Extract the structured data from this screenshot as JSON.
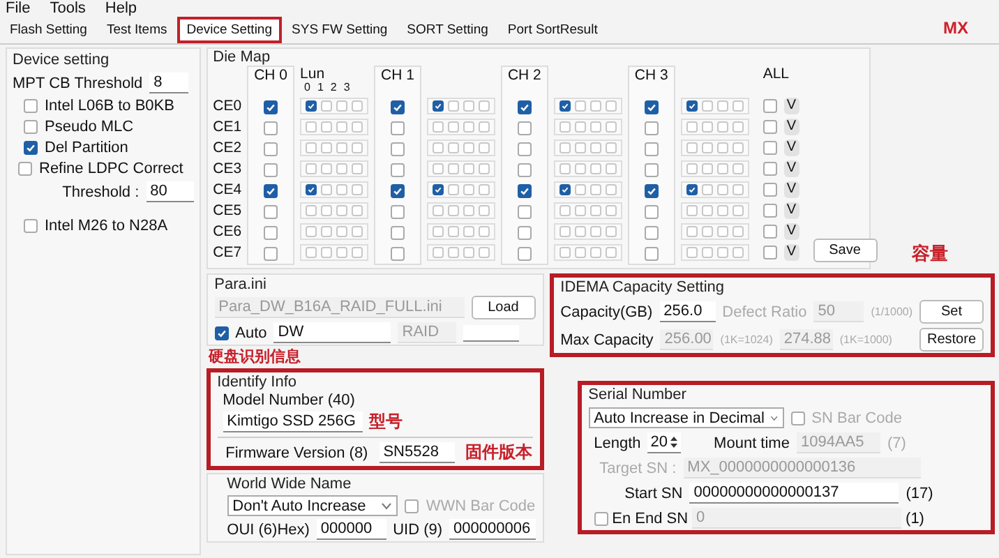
{
  "menu": [
    {
      "label": "File"
    },
    {
      "label": "Tools"
    },
    {
      "label": "Help"
    }
  ],
  "tabs": [
    {
      "label": "Flash Setting",
      "selected": false
    },
    {
      "label": "Test Items",
      "selected": false
    },
    {
      "label": "Device Setting",
      "selected": true
    },
    {
      "label": "SYS FW Setting",
      "selected": false
    },
    {
      "label": "SORT Setting",
      "selected": false
    },
    {
      "label": "Port SortResult",
      "selected": false
    }
  ],
  "corner_note": "MX",
  "device_setting": {
    "title": "Device setting",
    "items": [
      {
        "kind": "field",
        "label": "MPT CB Threshold",
        "value": "8"
      },
      {
        "kind": "checkbox",
        "label": "Intel L06B to B0KB",
        "checked": false
      },
      {
        "kind": "checkbox",
        "label": "Pseudo MLC",
        "checked": false
      },
      {
        "kind": "checkbox",
        "label": "Del Partition",
        "checked": true
      },
      {
        "kind": "checkbox",
        "label": "Refine LDPC Correct",
        "checked": false
      },
      {
        "kind": "subfield",
        "label": "Threshold :",
        "value": "80"
      },
      {
        "kind": "checkbox",
        "label": "Intel M26 to N28A",
        "checked": false
      }
    ]
  },
  "die_map": {
    "title": "Die Map",
    "lun_label": "Lun",
    "lun_numbers": [
      "0",
      "1",
      "2",
      "3"
    ],
    "channels": [
      "CH 0",
      "CH 1",
      "CH 2",
      "CH 3"
    ],
    "all_label": "ALL",
    "save": "Save",
    "rows": [
      {
        "ce": "CE0",
        "channels": [
          {
            "checked": true,
            "luns": [
              true,
              false,
              false,
              false
            ]
          },
          {
            "checked": true,
            "luns": [
              true,
              false,
              false,
              false
            ]
          },
          {
            "checked": true,
            "luns": [
              true,
              false,
              false,
              false
            ]
          },
          {
            "checked": true,
            "luns": [
              true,
              false,
              false,
              false
            ]
          }
        ],
        "all": false,
        "v": "V"
      },
      {
        "ce": "CE1",
        "channels": [
          {
            "checked": false,
            "luns": [
              false,
              false,
              false,
              false
            ]
          },
          {
            "checked": false,
            "luns": [
              false,
              false,
              false,
              false
            ]
          },
          {
            "checked": false,
            "luns": [
              false,
              false,
              false,
              false
            ]
          },
          {
            "checked": false,
            "luns": [
              false,
              false,
              false,
              false
            ]
          }
        ],
        "all": false,
        "v": "V"
      },
      {
        "ce": "CE2",
        "channels": [
          {
            "checked": false,
            "luns": [
              false,
              false,
              false,
              false
            ]
          },
          {
            "checked": false,
            "luns": [
              false,
              false,
              false,
              false
            ]
          },
          {
            "checked": false,
            "luns": [
              false,
              false,
              false,
              false
            ]
          },
          {
            "checked": false,
            "luns": [
              false,
              false,
              false,
              false
            ]
          }
        ],
        "all": false,
        "v": "V"
      },
      {
        "ce": "CE3",
        "channels": [
          {
            "checked": false,
            "luns": [
              false,
              false,
              false,
              false
            ]
          },
          {
            "checked": false,
            "luns": [
              false,
              false,
              false,
              false
            ]
          },
          {
            "checked": false,
            "luns": [
              false,
              false,
              false,
              false
            ]
          },
          {
            "checked": false,
            "luns": [
              false,
              false,
              false,
              false
            ]
          }
        ],
        "all": false,
        "v": "V"
      },
      {
        "ce": "CE4",
        "channels": [
          {
            "checked": true,
            "luns": [
              true,
              false,
              false,
              false
            ]
          },
          {
            "checked": true,
            "luns": [
              true,
              false,
              false,
              false
            ]
          },
          {
            "checked": true,
            "luns": [
              true,
              false,
              false,
              false
            ]
          },
          {
            "checked": true,
            "luns": [
              true,
              false,
              false,
              false
            ]
          }
        ],
        "all": false,
        "v": "V"
      },
      {
        "ce": "CE5",
        "channels": [
          {
            "checked": false,
            "luns": [
              false,
              false,
              false,
              false
            ]
          },
          {
            "checked": false,
            "luns": [
              false,
              false,
              false,
              false
            ]
          },
          {
            "checked": false,
            "luns": [
              false,
              false,
              false,
              false
            ]
          },
          {
            "checked": false,
            "luns": [
              false,
              false,
              false,
              false
            ]
          }
        ],
        "all": false,
        "v": "V"
      },
      {
        "ce": "CE6",
        "channels": [
          {
            "checked": false,
            "luns": [
              false,
              false,
              false,
              false
            ]
          },
          {
            "checked": false,
            "luns": [
              false,
              false,
              false,
              false
            ]
          },
          {
            "checked": false,
            "luns": [
              false,
              false,
              false,
              false
            ]
          },
          {
            "checked": false,
            "luns": [
              false,
              false,
              false,
              false
            ]
          }
        ],
        "all": false,
        "v": "V"
      },
      {
        "ce": "CE7",
        "channels": [
          {
            "checked": false,
            "luns": [
              false,
              false,
              false,
              false
            ]
          },
          {
            "checked": false,
            "luns": [
              false,
              false,
              false,
              false
            ]
          },
          {
            "checked": false,
            "luns": [
              false,
              false,
              false,
              false
            ]
          },
          {
            "checked": false,
            "luns": [
              false,
              false,
              false,
              false
            ]
          }
        ],
        "all": false,
        "v": "V"
      }
    ]
  },
  "capacity_note": "容量",
  "para_ini": {
    "title": "Para.ini",
    "file": {
      "value": "Para_DW_B16A_RAID_FULL.ini",
      "disabled": true
    },
    "load": "Load",
    "auto": {
      "label": "Auto",
      "checked": true
    },
    "field_1": {
      "value": "DW",
      "disabled": false
    },
    "field_2": {
      "value": "RAID",
      "disabled": true
    }
  },
  "identify_note": "硬盘识别信息",
  "identify_info": {
    "title": "Identify Info",
    "model_label": "Model Number (40)",
    "model": {
      "value": "Kimtigo SSD 256G",
      "disabled": false
    },
    "model_note": "型号",
    "fw_label": "Firmware Version (8)",
    "fw": {
      "value": "SN5528",
      "disabled": false
    },
    "fw_note": "固件版本"
  },
  "wwn": {
    "title": "World Wide Name",
    "mode": "Don't Auto Increase",
    "barcode": {
      "label": "WWN Bar Code",
      "checked": false
    },
    "oui_label": "OUI (6)Hex)",
    "oui": {
      "value": "000000",
      "disabled": false
    },
    "uid_label": "UID (9)",
    "uid": {
      "value": "000000006",
      "disabled": false
    }
  },
  "idema": {
    "title": "IDEMA Capacity Setting",
    "capacity_label": "Capacity(GB)",
    "capacity": {
      "value": "256.0",
      "disabled": false
    },
    "defect_label": "Defect Ratio",
    "defect": {
      "value": "50",
      "disabled": true
    },
    "defect_unit": "(1/1000)",
    "set": "Set",
    "max_label": "Max Capacity",
    "max_1024": {
      "value": "256.00",
      "disabled": true
    },
    "unit_1024": "(1K=1024)",
    "max_1000": {
      "value": "274.88",
      "disabled": true
    },
    "unit_1000": "(1K=1000)",
    "restore": "Restore"
  },
  "serial": {
    "title": "Serial Number",
    "mode": "Auto Increase in Decimal",
    "barcode": {
      "label": "SN Bar Code",
      "checked": false
    },
    "length_label": "Length",
    "length": "20",
    "mount_label": "Mount time",
    "mount": {
      "value": "1094AA5",
      "disabled": true
    },
    "mount_count": "(7)",
    "target_label": "Target SN :",
    "target": {
      "value": "MX_0000000000000136",
      "disabled": true
    },
    "start_label": "Start SN",
    "start": {
      "value": "00000000000000137",
      "disabled": false
    },
    "start_count": "(17)",
    "end_enable": {
      "label": "En",
      "checked": false
    },
    "end_label": "End SN",
    "end": {
      "value": "0",
      "disabled": true
    },
    "end_count": "(1)"
  }
}
